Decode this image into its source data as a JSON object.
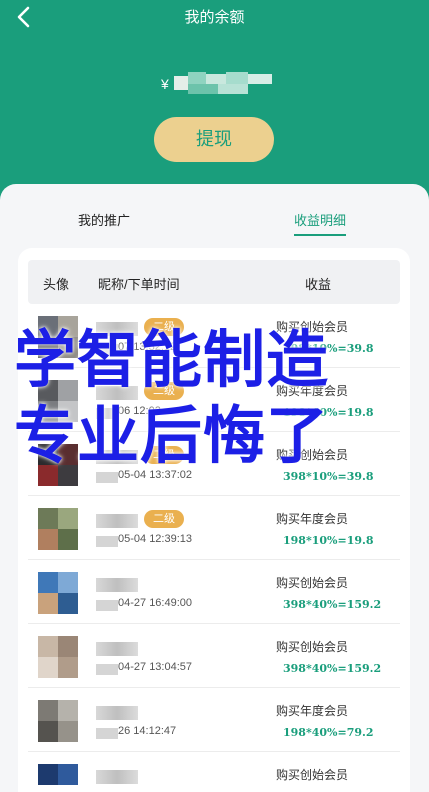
{
  "header": {
    "title": "我的余额",
    "balance_prefix": "¥",
    "withdraw_label": "提现"
  },
  "tabs": [
    {
      "label": "我的推广",
      "active": false
    },
    {
      "label": "收益明细",
      "active": true
    }
  ],
  "table": {
    "columns": [
      "头像",
      "昵称/下单时间",
      "收益"
    ],
    "rows": [
      {
        "badge": "二级",
        "time": "07 13:32:12",
        "desc": "购买创始会员",
        "calc": "398*10%=39.8"
      },
      {
        "badge": "二级",
        "time": "06 12:02",
        "desc": "购买年度会员",
        "calc": "198*10%=19.8"
      },
      {
        "badge": "二级",
        "time": "05-04 13:37:02",
        "desc": "购买创始会员",
        "calc": "398*10%=39.8"
      },
      {
        "badge": "二级",
        "time": "05-04 12:39:13",
        "desc": "购买年度会员",
        "calc": "198*10%=19.8"
      },
      {
        "badge": "",
        "time": "04-27 16:49:00",
        "desc": "购买创始会员",
        "calc": "398*40%=159.2"
      },
      {
        "badge": "",
        "time": "04-27 13:04:57",
        "desc": "购买创始会员",
        "calc": "398*40%=159.2"
      },
      {
        "badge": "",
        "time": "26 14:12:47",
        "desc": "购买年度会员",
        "calc": "198*40%=79.2"
      },
      {
        "badge": "",
        "time": "",
        "desc": "购买创始会员",
        "calc": ""
      }
    ]
  },
  "watermark": {
    "line1": "学智能制造",
    "line2": "专业后悔了"
  },
  "colors": {
    "brand": "#1a9e7c",
    "button": "#ecd08f",
    "badge": "#eab04f",
    "watermark": "#1c1fe6"
  }
}
